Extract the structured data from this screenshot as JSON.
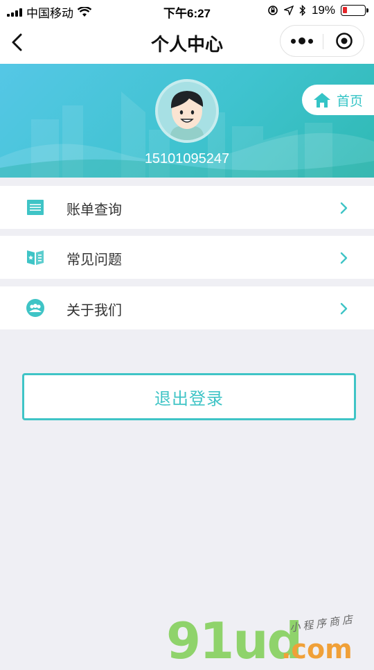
{
  "status_bar": {
    "carrier": "中国移动",
    "time": "下午6:27",
    "battery_percent": "19%",
    "battery_level": 0.19
  },
  "nav": {
    "title": "个人中心"
  },
  "profile": {
    "phone": "15101095247",
    "home_label": "首页"
  },
  "menu": [
    {
      "label": "账单查询",
      "icon": "bill-icon"
    },
    {
      "label": "常见问题",
      "icon": "faq-book-icon"
    },
    {
      "label": "关于我们",
      "icon": "about-us-icon"
    }
  ],
  "logout_label": "退出登录",
  "watermark": {
    "brand": "91ud",
    "suffix": ".com",
    "tagline": "小程序商店"
  },
  "colors": {
    "accent": "#3fc4c6",
    "background": "#efeff4",
    "battery_low": "#e5262a"
  }
}
